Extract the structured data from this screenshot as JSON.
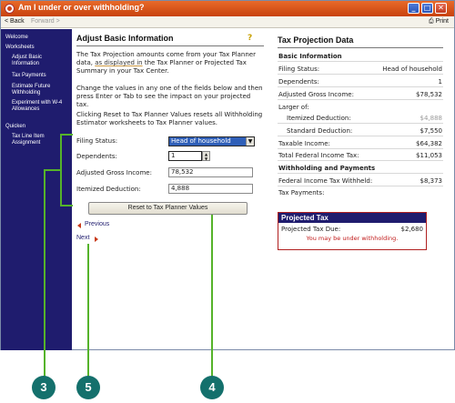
{
  "window": {
    "title": "Am I under or over withholding?"
  },
  "toolbar": {
    "back": "< Back",
    "forward": "Forward >",
    "print": "Print"
  },
  "sidebar": {
    "items": [
      {
        "label": "Welcome"
      },
      {
        "label": "Worksheets"
      },
      {
        "label": "Adjust Basic Information"
      },
      {
        "label": "Tax Payments"
      },
      {
        "label": "Estimate Future Withholding"
      },
      {
        "label": "Experiment with W-4 Allowances"
      },
      {
        "label": "Quicken"
      },
      {
        "label": "Tax Line Item Assignment"
      }
    ]
  },
  "main": {
    "heading": "Adjust Basic Information",
    "intro_part1": "The Tax Projection amounts come from your Tax Planner data, ",
    "intro_highlight": "as displayed in",
    "intro_part2": " the Tax Planner or Projected Tax Summary in your Tax Center.",
    "para2": "Change the values in any one of the fields below and then press Enter or Tab to see the impact on your projected tax.",
    "para3": "Clicking Reset to Tax Planner Values resets all Withholding Estimator worksheets to Tax Planner values.",
    "fields": {
      "filing_status_label": "Filing Status:",
      "filing_status_value": "Head of household",
      "dependents_label": "Dependents:",
      "dependents_value": "1",
      "agi_label": "Adjusted Gross Income:",
      "agi_value": "78,532",
      "itemized_label": "Itemized Deduction:",
      "itemized_value": "4,888"
    },
    "reset_label": "Reset to Tax Planner Values",
    "previous_label": "Previous",
    "next_label": "Next"
  },
  "projection": {
    "heading": "Tax Projection Data",
    "basic_info": "Basic Information",
    "filing_status_label": "Filing Status:",
    "filing_status_value": "Head of household",
    "dependents_label": "Dependents:",
    "dependents_value": "1",
    "agi_label": "Adjusted Gross Income:",
    "agi_value": "$78,532",
    "larger_of": "Larger of:",
    "itemized_label": "Itemized Deduction:",
    "itemized_value": "$4,888",
    "standard_label": "Standard Deduction:",
    "standard_value": "$7,550",
    "taxable_label": "Taxable Income:",
    "taxable_value": "$64,382",
    "total_tax_label": "Total Federal Income Tax:",
    "total_tax_value": "$11,053",
    "withholding_heading": "Withholding and Payments",
    "withheld_label": "Federal Income Tax Withheld:",
    "withheld_value": "$8,373",
    "payments_label": "Tax Payments:",
    "payments_value": ""
  },
  "projected_tax": {
    "heading": "Projected Tax",
    "due_label": "Projected Tax Due:",
    "due_value": "$2,680",
    "warning": "You may be under withholding."
  },
  "callouts": [
    "3",
    "5",
    "4"
  ],
  "colors": {
    "sidebar": "#1f1c6e",
    "titlebar": "#d0531a",
    "callout_bubble": "#14706c",
    "callout_line": "#55b32a",
    "warning": "#c01818"
  }
}
